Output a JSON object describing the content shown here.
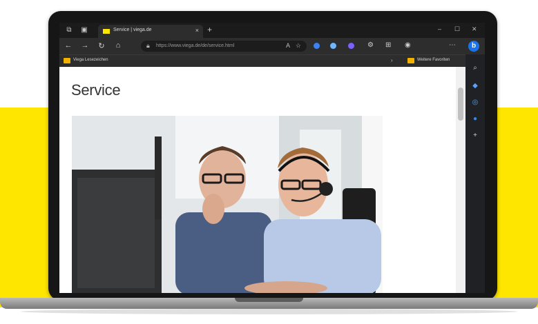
{
  "browser": {
    "tab": {
      "title": "Service | viega.de",
      "close_glyph": "×"
    },
    "new_tab_glyph": "+",
    "url": "https://www.viega.de/de/service.html",
    "favorites_bar": {
      "left_item": "Viega Lesezeichen",
      "right_item": "Weitere Favoriten"
    }
  },
  "page": {
    "heading": "Service"
  },
  "colors": {
    "brand_yellow": "#ffe600",
    "browser_dark": "#202124",
    "edge_blue": "#1a73e8"
  },
  "icons": [
    "workspaces-icon",
    "tab-actions-icon",
    "back-icon",
    "forward-icon",
    "refresh-icon",
    "home-icon",
    "lock-icon",
    "favorite-star-icon",
    "read-aloud-icon",
    "extensions-icon",
    "collections-icon",
    "settings-menu-icon",
    "bing-icon",
    "search-icon",
    "shopping-icon",
    "outlook-icon",
    "add-icon"
  ]
}
